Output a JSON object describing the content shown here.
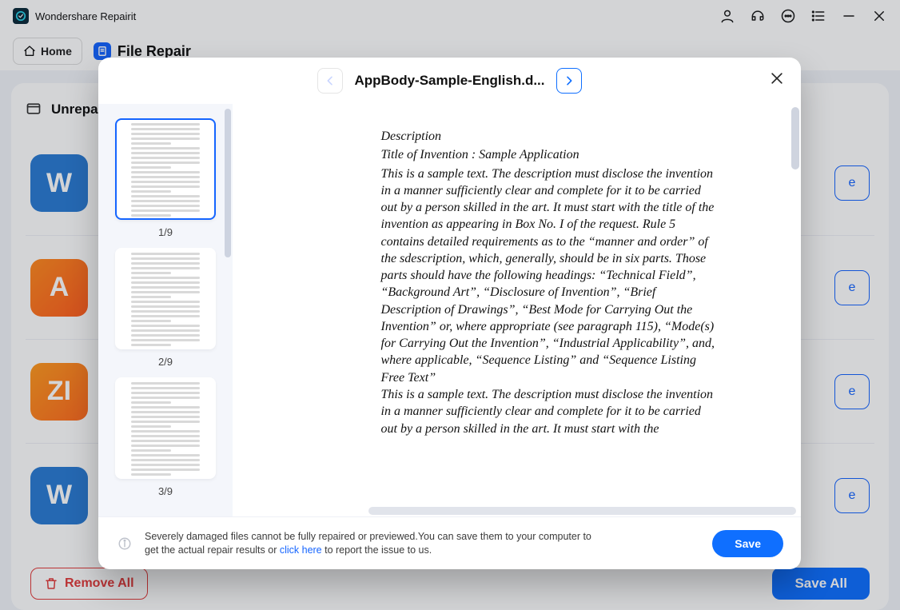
{
  "app": {
    "title": "Wondershare Repairit"
  },
  "header": {
    "home": "Home",
    "section": "File Repair"
  },
  "panel": {
    "title": "Unrepai"
  },
  "list": {
    "rows": [
      {
        "iconText": "W",
        "iconClass": "ico-word",
        "actionText": "e"
      },
      {
        "iconText": "A",
        "iconClass": "ico-ai",
        "actionText": "e"
      },
      {
        "iconText": "ZI",
        "iconClass": "ico-zip",
        "actionText": "e"
      },
      {
        "iconText": "W",
        "iconClass": "ico-word",
        "actionText": "e"
      }
    ]
  },
  "footer": {
    "removeAll": "Remove All",
    "saveAll": "Save All"
  },
  "modal": {
    "filename": "AppBody-Sample-English.d...",
    "thumbs": [
      {
        "label": "1/9",
        "active": true
      },
      {
        "label": "2/9",
        "active": false
      },
      {
        "label": "3/9",
        "active": false
      }
    ],
    "notice_a": "Severely damaged files cannot be fully repaired or previewed.You can save them to your computer to get the actual repair results or ",
    "notice_link": "click here",
    "notice_b": " to report the issue to us.",
    "save": "Save",
    "doc": {
      "heading": "Description",
      "title": "Title of Invention : Sample Application",
      "para1": "This is a sample text. The description must disclose the invention in a manner sufficiently clear and complete for it to be carried out by a person skilled in the art. It must start with the title of the invention as appearing in Box No. I of the request. Rule 5 contains detailed requirements as to the “manner and order” of the sdescription, which, generally, should be in six parts. Those parts should have the following headings: “Technical Field”, “Background Art”, “Disclosure of Invention”, “Brief Description of Drawings”, “Best Mode for Carrying Out the Invention” or, where appropriate (see paragraph 115), “Mode(s) for Carrying Out the Invention”, “Industrial Applicability”, and, where applicable, “Sequence Listing” and “Sequence Listing Free Text”",
      "para2": "This is a sample text. The description must disclose the invention in a manner sufficiently clear and complete for it to be carried out by a person skilled in the art. It must start with the"
    }
  }
}
